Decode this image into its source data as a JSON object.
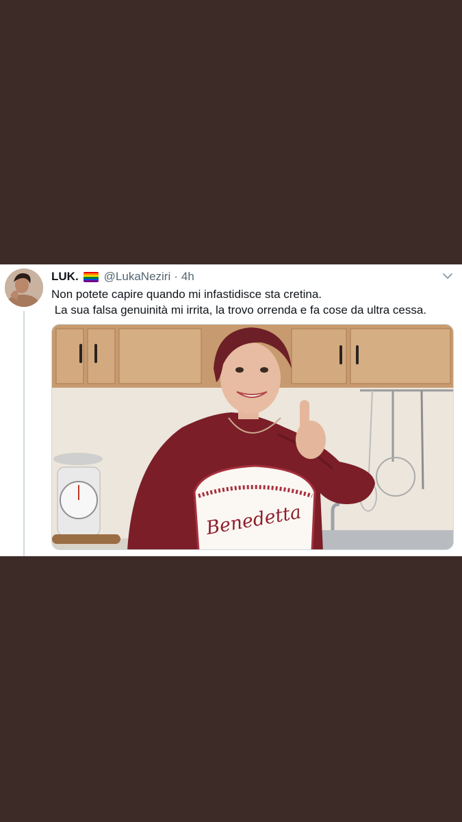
{
  "tweet": {
    "display_name": "LUK.",
    "flag_icon": "rainbow-flag-icon",
    "handle": "@LukaNeziri",
    "separator": "·",
    "time": "4h",
    "lines": [
      "Non potete capire quando mi infastidisce sta cretina.",
      " La sua falsa genuinità mi irrita, la trovo orrenda e fa cose da ultra cessa."
    ],
    "apron_text": "Benedetta"
  },
  "colors": {
    "background": "#3d2b28",
    "card": "#ffffff",
    "text": "#0f1419",
    "muted": "#536471"
  }
}
